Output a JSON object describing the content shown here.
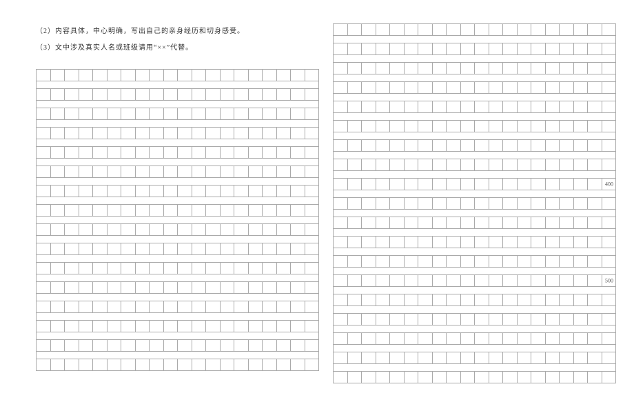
{
  "instructions": {
    "line1": "（2）内容具体，中心明确，写出自己的亲身经历和切身感受。",
    "line2": "（3）文中涉及真实人名或班级请用“××”代替。"
  },
  "grid": {
    "cells_per_row": 20,
    "left_rows": 16,
    "right_rows": 19,
    "right_markers": {
      "row_9": "400",
      "row_14": "500"
    }
  }
}
